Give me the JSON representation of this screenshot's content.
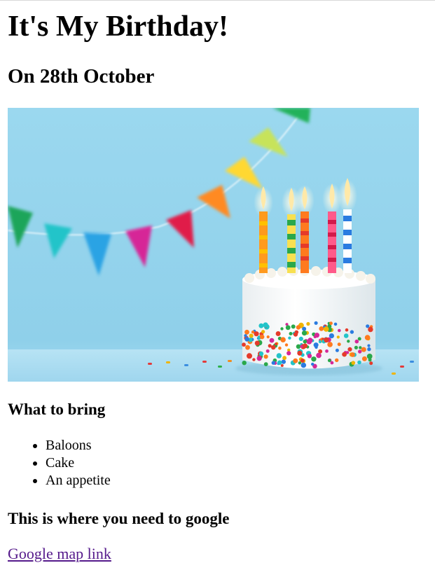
{
  "page": {
    "title": "It's My Birthday!",
    "subtitle": "On 28th October"
  },
  "image": {
    "description_name": "birthday-cake-image"
  },
  "bring": {
    "heading": "What to bring",
    "items": [
      "Baloons",
      "Cake",
      "An appetite"
    ]
  },
  "location": {
    "heading": "This is where you need to google",
    "link_text": "Google map link"
  },
  "colors": {
    "link_visited": "#551a8b",
    "sky_blue": "#8fd3ec"
  }
}
